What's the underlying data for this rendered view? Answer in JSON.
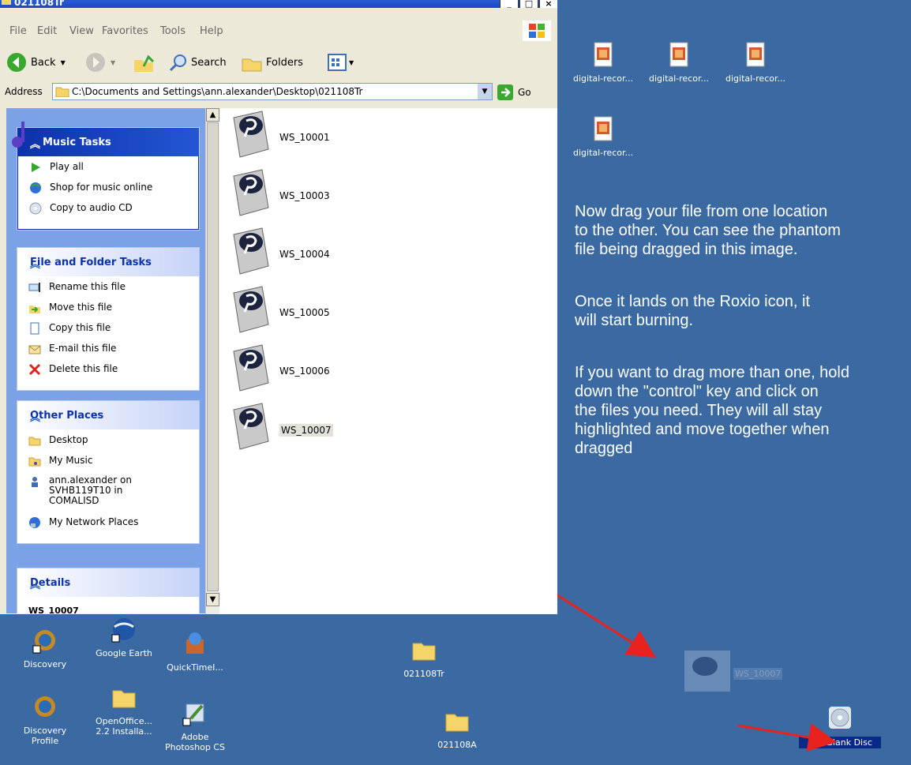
{
  "window": {
    "title": "021108Tr",
    "menu": [
      "File",
      "Edit",
      "View",
      "Favorites",
      "Tools",
      "Help"
    ],
    "toolbar": {
      "back": "Back",
      "search": "Search",
      "folders": "Folders"
    },
    "address": {
      "label": "Address",
      "value": "C:\\Documents and Settings\\ann.alexander\\Desktop\\021108Tr",
      "go": "Go"
    }
  },
  "panels": {
    "music": {
      "title": "Music Tasks",
      "items": [
        "Play all",
        "Shop for music online",
        "Copy to audio CD"
      ]
    },
    "file_folder": {
      "title": "File and Folder Tasks",
      "items": [
        "Rename this file",
        "Move this file",
        "Copy this file",
        "E-mail this file",
        "Delete this file"
      ]
    },
    "other": {
      "title": "Other Places",
      "items": [
        "Desktop",
        "My Music",
        "ann.alexander on SVHB119T10 in COMALISD",
        "My Network Places"
      ]
    },
    "details": {
      "title": "Details",
      "partial": "WS_10007"
    }
  },
  "files": [
    "WS_10001",
    "WS_10003",
    "WS_10004",
    "WS_10005",
    "WS_10006",
    "WS_10007"
  ],
  "desktop": {
    "top_icons": [
      "digital-recor...",
      "digital-recor...",
      "digital-recor...",
      "digital-recor..."
    ],
    "bottom_icons": [
      {
        "label": "Discovery",
        "kind": "discovery"
      },
      {
        "label": "Google Earth",
        "kind": "earth"
      },
      {
        "label": "QuickTimeI...",
        "kind": "quicktime"
      },
      {
        "label": "021108Tr",
        "kind": "folder"
      },
      {
        "label": "Discovery Profile",
        "kind": "discovery"
      },
      {
        "label": "OpenOffice... 2.2 Installa...",
        "kind": "folder"
      },
      {
        "label": "Adobe Photoshop CS",
        "kind": "photoshop"
      },
      {
        "label": "021108A",
        "kind": "folder"
      },
      {
        "label": "(D:) Blank Disc",
        "kind": "disc"
      }
    ],
    "ghost_label": "WS_10007"
  },
  "notes": [
    "Now drag your file from one location\nto the other.  You can see the phantom\nfile being dragged in this image.",
    "Once it lands on the Roxio icon, it\nwill start burning.",
    "If you want to drag more than one, hold\ndown the \"control\" key and click on\nthe files you need.  They will all stay\nhighlighted and move together when\ndragged"
  ],
  "colors": {
    "desktop": "#3b6aa3",
    "arrow": "#e8231f",
    "panel_header": "#215dc6"
  }
}
